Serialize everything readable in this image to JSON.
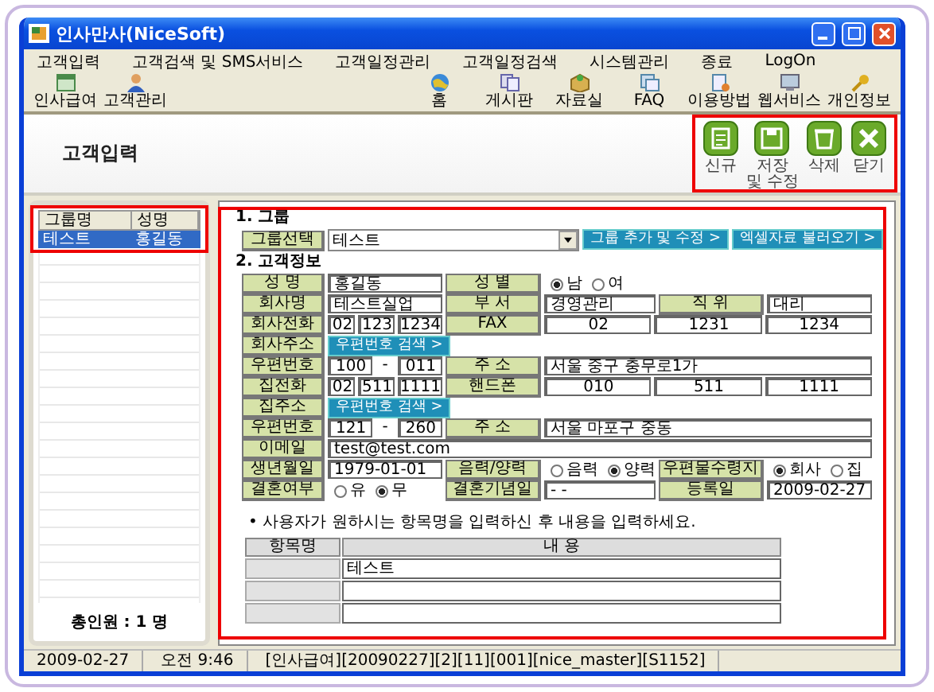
{
  "window": {
    "title": "인사만사(NiceSoft)"
  },
  "menu": [
    "고객입력",
    "고객검색 및 SMS서비스",
    "고객일정관리",
    "고객일정검색",
    "시스템관리",
    "종료",
    "LogOn"
  ],
  "toolbar": {
    "left": [
      "인사급여",
      "고객관리"
    ],
    "right": [
      "홈",
      "게시판",
      "자료실",
      "FAQ",
      "이용방법",
      "웹서비스",
      "개인정보"
    ]
  },
  "page_title": "고객입력",
  "actions": [
    "신규",
    "저장\n및 수정",
    "삭제",
    "닫기"
  ],
  "customer_list": {
    "columns": [
      "그룹명",
      "성명"
    ],
    "rows": [
      {
        "group": "테스트",
        "name": "홍길동",
        "selected": true
      }
    ],
    "total": "총인원 :  1 명"
  },
  "form": {
    "group_heading": "1. 그룹",
    "group_label": "그룹선택",
    "group_value": "테스트",
    "group_buttons": [
      "그룹 추가 및 수정 >",
      "엑셀자료 불러오기 >"
    ],
    "info_heading": "2. 고객정보",
    "rows": [
      {
        "cells": [
          {
            "kind": "label",
            "text": "성 명"
          },
          {
            "kind": "field",
            "value": "홍길동"
          },
          {
            "kind": "label",
            "text": "성 별"
          },
          {
            "kind": "radios",
            "options": [
              {
                "label": "남",
                "selected": true
              },
              {
                "label": "여",
                "selected": false
              }
            ]
          }
        ]
      },
      {
        "cells": [
          {
            "kind": "label",
            "text": "회사명"
          },
          {
            "kind": "field",
            "value": "테스트실업"
          },
          {
            "kind": "label",
            "text": "부 서"
          },
          {
            "kind": "field",
            "value": "경영관리"
          },
          {
            "kind": "label",
            "text": "직 위"
          },
          {
            "kind": "field",
            "value": "대리"
          }
        ]
      },
      {
        "cells": [
          {
            "kind": "label",
            "text": "회사전화"
          },
          {
            "kind": "parts",
            "parts": [
              "02",
              "123",
              "1234"
            ]
          },
          {
            "kind": "label",
            "text": "FAX"
          },
          {
            "kind": "parts",
            "parts": [
              "02",
              "1231",
              "1234"
            ]
          }
        ]
      },
      {
        "cells": [
          {
            "kind": "label",
            "text": "회사주소"
          },
          {
            "kind": "button",
            "text": "우편번호 검색 >"
          }
        ]
      },
      {
        "cells": [
          {
            "kind": "label",
            "text": "우편번호"
          },
          {
            "kind": "zip",
            "parts": [
              "100",
              "011"
            ],
            "separator": "-"
          },
          {
            "kind": "label",
            "text": "주 소"
          },
          {
            "kind": "field",
            "value": "서울 중구 충무로1가"
          }
        ]
      },
      {
        "cells": [
          {
            "kind": "label",
            "text": "집전화"
          },
          {
            "kind": "parts",
            "parts": [
              "02",
              "511",
              "1111"
            ]
          },
          {
            "kind": "label",
            "text": "핸드폰"
          },
          {
            "kind": "parts",
            "parts": [
              "010",
              "511",
              "1111"
            ]
          }
        ]
      },
      {
        "cells": [
          {
            "kind": "label",
            "text": "집주소"
          },
          {
            "kind": "button",
            "text": "우편번호 검색 >"
          }
        ]
      },
      {
        "cells": [
          {
            "kind": "label",
            "text": "우편번호"
          },
          {
            "kind": "zip",
            "parts": [
              "121",
              "260"
            ],
            "separator": "-"
          },
          {
            "kind": "label",
            "text": "주 소"
          },
          {
            "kind": "field",
            "value": "서울 마포구 중동"
          }
        ]
      },
      {
        "cells": [
          {
            "kind": "label",
            "text": "이메일"
          },
          {
            "kind": "field",
            "value": "test@test.com"
          }
        ]
      },
      {
        "cells": [
          {
            "kind": "label",
            "text": "생년월일"
          },
          {
            "kind": "field",
            "value": "1979-01-01"
          },
          {
            "kind": "label",
            "text": "음력/양력"
          },
          {
            "kind": "radios",
            "options": [
              {
                "label": "음력",
                "selected": false
              },
              {
                "label": "양력",
                "selected": true
              }
            ]
          },
          {
            "kind": "label",
            "text": "우편물수령지"
          },
          {
            "kind": "radios",
            "options": [
              {
                "label": "회사",
                "selected": true
              },
              {
                "label": "집",
                "selected": false
              }
            ]
          }
        ]
      },
      {
        "cells": [
          {
            "kind": "label",
            "text": "결혼여부"
          },
          {
            "kind": "radios",
            "options": [
              {
                "label": "유",
                "selected": false
              },
              {
                "label": "무",
                "selected": true
              }
            ]
          },
          {
            "kind": "label",
            "text": "결혼기념일"
          },
          {
            "kind": "field",
            "value": "- -"
          },
          {
            "kind": "label",
            "text": "등록일"
          },
          {
            "kind": "field",
            "value": "2009-02-27"
          }
        ]
      }
    ]
  },
  "custom_fields": {
    "note": "• 사용자가 원하시는 항목명을 입력하신 후 내용을 입력하세요.",
    "columns": [
      "항목명",
      "내 용"
    ],
    "rows": [
      {
        "kind": "filled",
        "content": "테스트"
      },
      {
        "kind": "blank"
      },
      {
        "kind": "blank"
      }
    ]
  },
  "status_bar": [
    "2009-02-27",
    "오전 9:46",
    "[인사급여][20090227][2][11][001][nice_master][S1152]"
  ]
}
